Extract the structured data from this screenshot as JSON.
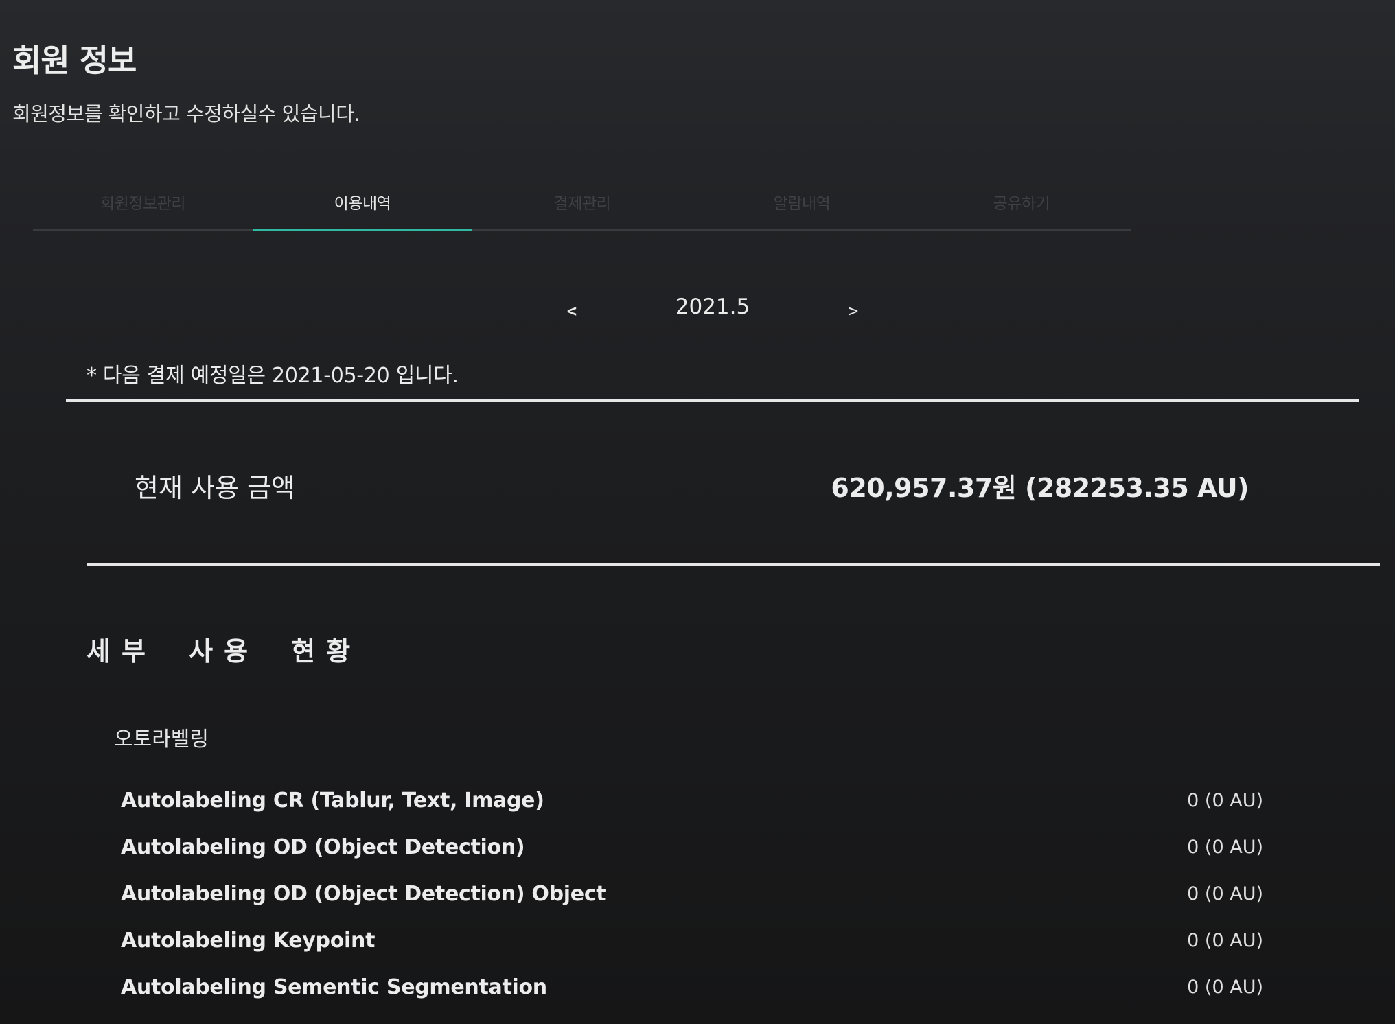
{
  "header": {
    "title": "회원 정보",
    "subtitle": "회원정보를 확인하고 수정하실수 있습니다."
  },
  "tabs": [
    {
      "label": "회원정보관리",
      "active": false
    },
    {
      "label": "이용내역",
      "active": true
    },
    {
      "label": "결제관리",
      "active": false
    },
    {
      "label": "알람내역",
      "active": false
    },
    {
      "label": "공유하기",
      "active": false
    }
  ],
  "month_nav": {
    "prev": "<",
    "current": "2021.5",
    "next": ">"
  },
  "next_payment_notice": "* 다음 결제 예정일은 2021-05-20 입니다.",
  "current_usage": {
    "label": "현재 사용 금액",
    "value": "620,957.37원 (282253.35 AU)"
  },
  "details": {
    "heading": "세부 사용 현황",
    "category": "오토라벨링",
    "items": [
      {
        "name": "Autolabeling CR (Tablur, Text, Image)",
        "value": "0 (0 AU)"
      },
      {
        "name": "Autolabeling OD (Object Detection)",
        "value": "0 (0 AU)"
      },
      {
        "name": "Autolabeling OD (Object Detection) Object",
        "value": "0 (0 AU)"
      },
      {
        "name": "Autolabeling Keypoint",
        "value": "0 (0 AU)"
      },
      {
        "name": "Autolabeling Sementic Segmentation",
        "value": "0 (0 AU)"
      }
    ]
  },
  "colors": {
    "accent": "#2fb8a4",
    "background": "#1c1d1f",
    "inactive_tab": "#3f4043"
  }
}
